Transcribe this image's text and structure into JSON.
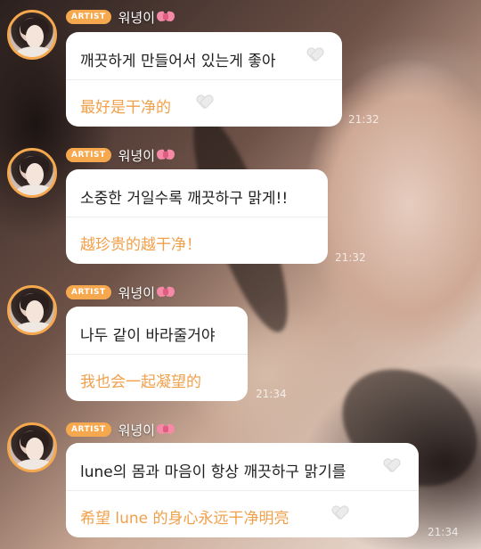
{
  "artist_badge": "ARTIST",
  "messages": [
    {
      "name": "워녕이",
      "ko": "깨끗하게 만들어서 있는게 좋아",
      "zh": "最好是干净的",
      "time": "21:32"
    },
    {
      "name": "워녕이",
      "ko": "소중한 거일수록 깨끗하구 맑게!!",
      "zh": "越珍贵的越干净！",
      "time": "21:32"
    },
    {
      "name": "워녕이",
      "ko": "나두 같이 바라줄거야",
      "zh": "我也会一起凝望的",
      "time": "21:34"
    },
    {
      "name": "워녕이",
      "ko": "lune의 몸과 마음이 항상 깨끗하구 맑기를",
      "zh": "希望 lune 的身心永远干净明亮",
      "time": "21:34"
    }
  ]
}
